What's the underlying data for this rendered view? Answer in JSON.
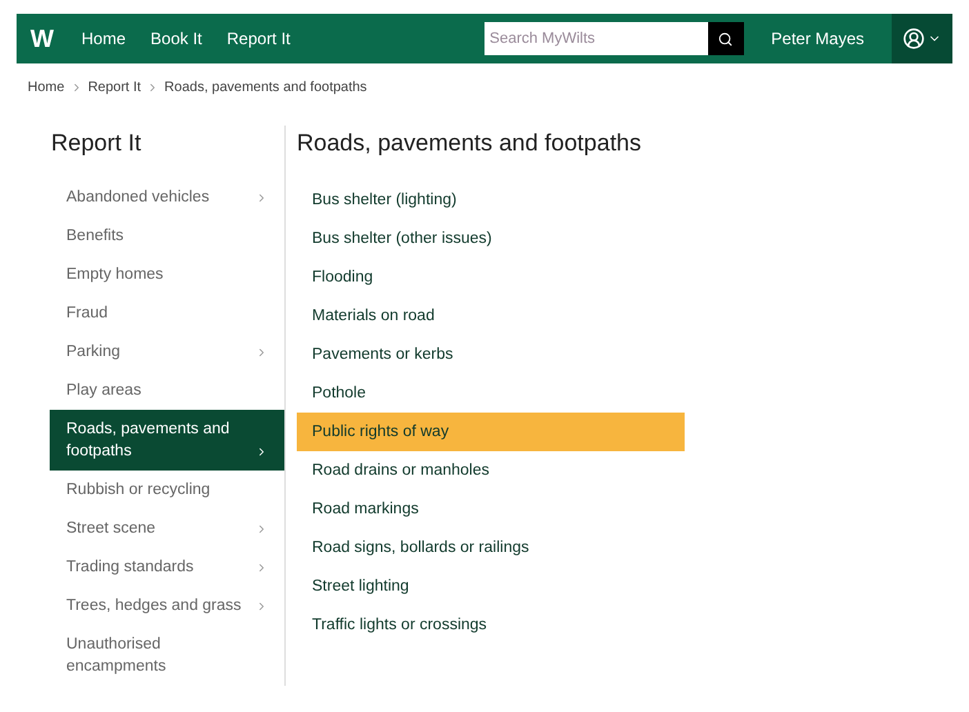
{
  "header": {
    "logo": "W",
    "nav": [
      "Home",
      "Book It",
      "Report It"
    ],
    "search": {
      "placeholder": "Search MyWilts"
    },
    "user": "Peter Mayes"
  },
  "breadcrumb": [
    "Home",
    "Report It",
    "Roads, pavements and footpaths"
  ],
  "sidebar": {
    "title": "Report It",
    "items": [
      {
        "label": "Abandoned vehicles",
        "submenu": true,
        "selected": false
      },
      {
        "label": "Benefits",
        "submenu": false,
        "selected": false
      },
      {
        "label": "Empty homes",
        "submenu": false,
        "selected": false
      },
      {
        "label": "Fraud",
        "submenu": false,
        "selected": false
      },
      {
        "label": "Parking",
        "submenu": true,
        "selected": false
      },
      {
        "label": "Play areas",
        "submenu": false,
        "selected": false
      },
      {
        "label": "Roads, pavements and footpaths",
        "submenu": true,
        "selected": true
      },
      {
        "label": "Rubbish or recycling",
        "submenu": false,
        "selected": false
      },
      {
        "label": "Street scene",
        "submenu": true,
        "selected": false
      },
      {
        "label": "Trading standards",
        "submenu": true,
        "selected": false
      },
      {
        "label": "Trees, hedges and grass",
        "submenu": true,
        "selected": false
      },
      {
        "label": "Unauthorised encampments",
        "submenu": false,
        "selected": false
      }
    ]
  },
  "content": {
    "title": "Roads, pavements and footpaths",
    "items": [
      {
        "label": "Bus shelter (lighting)",
        "selected": false
      },
      {
        "label": "Bus shelter (other issues)",
        "selected": false
      },
      {
        "label": "Flooding",
        "selected": false
      },
      {
        "label": "Materials on road",
        "selected": false
      },
      {
        "label": "Pavements or kerbs",
        "selected": false
      },
      {
        "label": "Pothole",
        "selected": false
      },
      {
        "label": "Public rights of way",
        "selected": true
      },
      {
        "label": "Road drains or manholes",
        "selected": false
      },
      {
        "label": "Road markings",
        "selected": false
      },
      {
        "label": "Road signs, bollards or railings",
        "selected": false
      },
      {
        "label": "Street lighting",
        "selected": false
      },
      {
        "label": "Traffic lights or crossings",
        "selected": false
      }
    ]
  }
}
